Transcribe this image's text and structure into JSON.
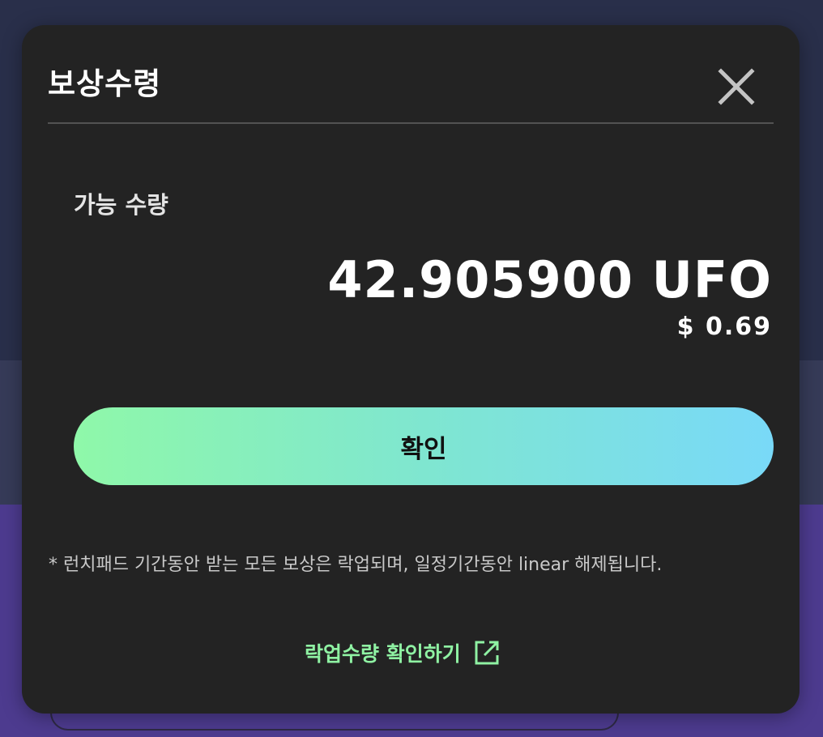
{
  "modal": {
    "title": "보상수령",
    "available_label": "가능 수량",
    "amount": "42.905900 UFO",
    "usd_value": "$ 0.69",
    "confirm_label": "확인",
    "notice": "* 런치패드 기간동안 받는 모든 보상은 락업되며, 일정기간동안 linear 해제됩니다.",
    "lockup_link_label": "락업수량 확인하기"
  },
  "icons": {
    "close": "close-icon",
    "external_link": "external-link-icon"
  },
  "colors": {
    "modal_background": "#232323",
    "gradient_start": "#8ff8a9",
    "gradient_end": "#79d9f8",
    "link_green": "#8ff2a3"
  }
}
